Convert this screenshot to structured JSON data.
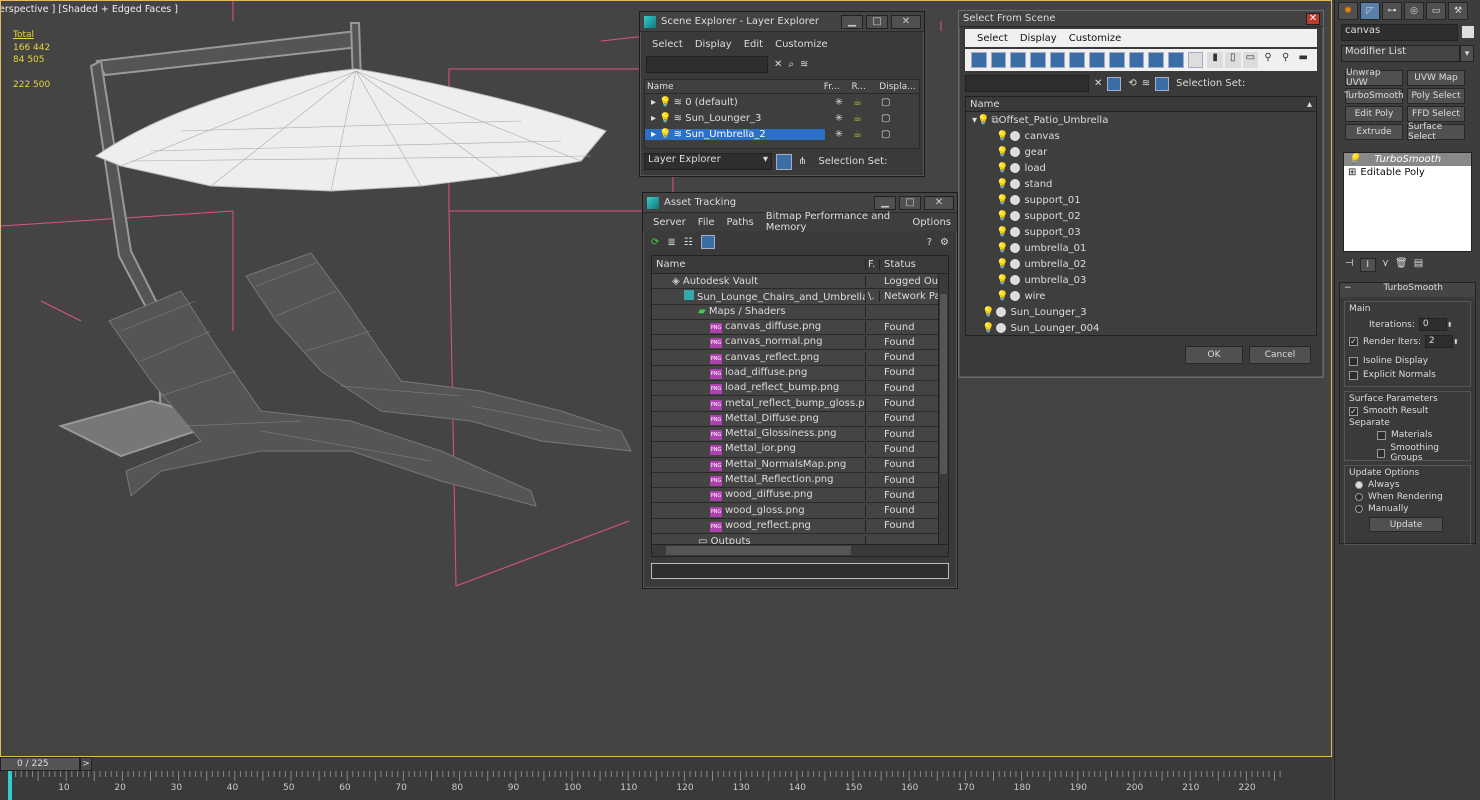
{
  "viewport": {
    "label": "erspective ] [Shaded + Edged Faces ]",
    "stats": [
      {
        "k": "",
        "v": "Total"
      },
      {
        "k": "",
        "v": "166 442"
      },
      {
        "k": "",
        "v": "84 505"
      },
      {
        "k": "",
        "v": ""
      },
      {
        "k": "",
        "v": "222 500"
      }
    ]
  },
  "scene_explorer": {
    "title": "Scene Explorer - Layer Explorer",
    "menus": [
      "Select",
      "Display",
      "Edit",
      "Customize"
    ],
    "columns": [
      "Name",
      "Fr...",
      "R...",
      "Displa..."
    ],
    "layers": [
      "0 (default)",
      "Sun_Lounger_3",
      "Sun_Umbrella_2"
    ],
    "footer_mode": "Layer Explorer",
    "selection_set_label": "Selection Set:"
  },
  "asset_tracking": {
    "title": "Asset Tracking",
    "menus": [
      "Server",
      "File",
      "Paths",
      "Bitmap Performance and Memory",
      "Options"
    ],
    "columns": [
      "Name",
      "F.",
      "Status"
    ],
    "vault": {
      "name": "Autodesk Vault",
      "status": "Logged Out"
    },
    "file": {
      "name": "Sun_Lounge_Chairs_and_Umbrella_v...",
      "f": "\\.",
      "status": "Network Pat"
    },
    "maps_label": "Maps / Shaders",
    "maps": [
      "canvas_diffuse.png",
      "canvas_normal.png",
      "canvas_reflect.png",
      "load_diffuse.png",
      "load_reflect_bump.png",
      "metal_reflect_bump_gloss.png",
      "Mettal_Diffuse.png",
      "Mettal_Glossiness.png",
      "Mettal_ior.png",
      "Mettal_NormalsMap.png",
      "Mettal_Reflection.png",
      "wood_diffuse.png",
      "wood_gloss.png",
      "wood_reflect.png"
    ],
    "found_label": "Found",
    "outputs_label": "Outputs"
  },
  "select_from_scene": {
    "title": "Select From Scene",
    "menus": [
      "Select",
      "Display",
      "Customize"
    ],
    "selection_set_label": "Selection Set:",
    "column": "Name",
    "root": "Offset_Patio_Umbrella",
    "children": [
      "canvas",
      "gear",
      "load",
      "stand",
      "support_01",
      "support_02",
      "support_03",
      "umbrella_01",
      "umbrella_02",
      "umbrella_03",
      "wire"
    ],
    "others": [
      "Sun_Lounger_3",
      "Sun_Lounger_004"
    ],
    "ok": "OK",
    "cancel": "Cancel"
  },
  "cmd": {
    "object_name": "canvas",
    "modifier_list": "Modifier List",
    "mod_buttons": [
      "Unwrap UVW",
      "UVW Map",
      "TurboSmooth",
      "Poly Select",
      "Edit Poly",
      "FFD Select",
      "Extrude",
      "Surface Select"
    ],
    "stack": [
      "TurboSmooth",
      "Editable Poly"
    ],
    "rollout_title": "TurboSmooth",
    "main_label": "Main",
    "iterations_label": "Iterations:",
    "iterations": "0",
    "render_iters_label": "Render Iters:",
    "render_iters": "2",
    "isoline": "Isoline Display",
    "explicit": "Explicit Normals",
    "surface_params": "Surface Parameters",
    "smooth_result": "Smooth Result",
    "separate": "Separate",
    "materials": "Materials",
    "smoothing_groups": "Smoothing Groups",
    "update_options": "Update Options",
    "always": "Always",
    "when_rendering": "When Rendering",
    "manually": "Manually",
    "update": "Update"
  },
  "timeline": {
    "frame": "0 / 225",
    "next": ">",
    "ticks": [
      "10",
      "20",
      "30",
      "40",
      "50",
      "60",
      "70",
      "80",
      "90",
      "100",
      "110",
      "120",
      "130",
      "140",
      "150",
      "160",
      "170",
      "180",
      "190",
      "200",
      "210",
      "220"
    ]
  },
  "colors": {
    "accent": "#e8b860",
    "selected": "#2a6fc8",
    "bulb": "#f0d040"
  }
}
